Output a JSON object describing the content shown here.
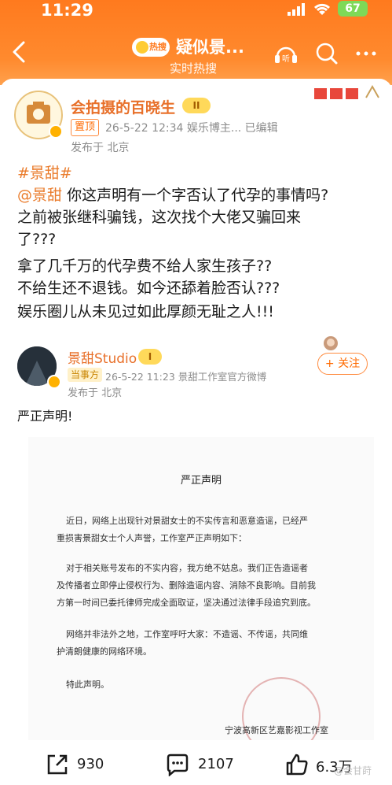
{
  "status_bar": {
    "time": "11:29",
    "battery": "67"
  },
  "nav": {
    "logo_text": "热搜",
    "title": "疑似景...",
    "subtitle": "实时热搜"
  },
  "post": {
    "author": "会拍摄的百晓生",
    "level": "II",
    "pinned_label": "置顶",
    "meta": "26-5-22 12:34  娱乐博主...  已编辑",
    "location": "发布于 北京",
    "hashtag": "#景甜#",
    "mention": "@景甜",
    "lines": [
      "你这声明有一个字否认了代孕的事情吗?",
      "之前被张继科骗钱，这次找个大佬又骗回来",
      "了???",
      "拿了几千万的代孕费不给人家生孩子??",
      "不给生还不退钱。如今还舔着脸否认???",
      "娱乐圈儿从未见过如此厚颜无耻之人!!!"
    ]
  },
  "repost": {
    "author": "景甜Studio",
    "level": "I",
    "tag": "当事方",
    "meta": "26-5-22 11:23  景甜工作室官方微博",
    "location": "发布于 北京",
    "follow_label": "+ 关注",
    "statement_header": "严正声明!",
    "document": {
      "title": "严正声明",
      "paragraphs": [
        "近日，网络上出现针对景甜女士的不实传言和恶意造谣，已经严",
        "重损害景甜女士个人声誉，工作室严正声明如下：",
        "对于相关账号发布的不实内容，我方绝不姑息。我们正告造谣者",
        "及传播者立即停止侵权行为、删除造谣内容、消除不良影响。目前我",
        "方第一时间已委托律师完成全面取证，坚决通过法律手段追究到底。",
        "网络并非法外之地，工作室呼吁大家：不造谣、不传谣，共同维",
        "护清朗健康的网络环境。",
        "特此声明。",
        "宁波高新区艺嘉影视工作室"
      ]
    }
  },
  "actions": {
    "repost_count": "930",
    "comment_count": "2107",
    "like_count": "6.3万"
  },
  "watermark": "@会甘莳"
}
